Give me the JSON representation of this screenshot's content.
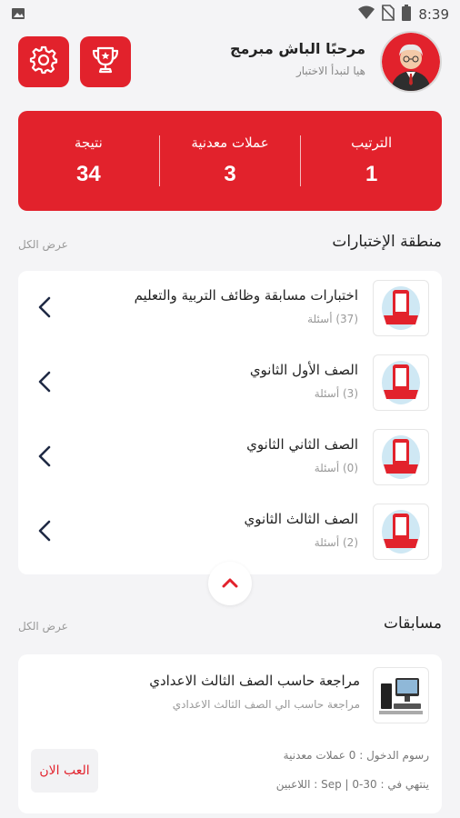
{
  "status_bar": {
    "time": "8:39",
    "icons": [
      "image-icon",
      "wifi-icon",
      "no-sim-icon",
      "battery-icon"
    ]
  },
  "header": {
    "greeting": "مرحبًا الباش مبرمج",
    "subtitle": "هيا لنبدأ الاختبار"
  },
  "stats": {
    "items": [
      {
        "label": "الترتيب",
        "value": "1"
      },
      {
        "label": "عملات معدنية",
        "value": "3"
      },
      {
        "label": "نتيجة",
        "value": "34"
      }
    ]
  },
  "quizzes": {
    "title": "منطقة الإختبارات",
    "see_all": "عرض الكل",
    "items": [
      {
        "title": "اختبارات مسابقة وظائف التربية والتعليم",
        "count": "(37) أسئلة"
      },
      {
        "title": "الصف الأول الثانوي",
        "count": "(3) أسئلة"
      },
      {
        "title": "الصف الثاني الثانوي",
        "count": "(0) أسئلة"
      },
      {
        "title": "الصف الثالث الثانوي",
        "count": "(2) أسئلة"
      }
    ]
  },
  "competitions": {
    "title": "مسابقات",
    "see_all": "عرض الكل",
    "item": {
      "title": "مراجعة حاسب الصف الثالث الاعدادي",
      "description": "مراجعة حاسب الي الصف الثالث الاعدادي",
      "fee": "رسوم الدخول : 0 عملات معدنية",
      "ends": "ينتهي في : 30-0 | Sep : اللاعبين",
      "play_label": "العب الان"
    }
  },
  "colors": {
    "accent": "#e2222c",
    "background": "#f4f4f6"
  }
}
